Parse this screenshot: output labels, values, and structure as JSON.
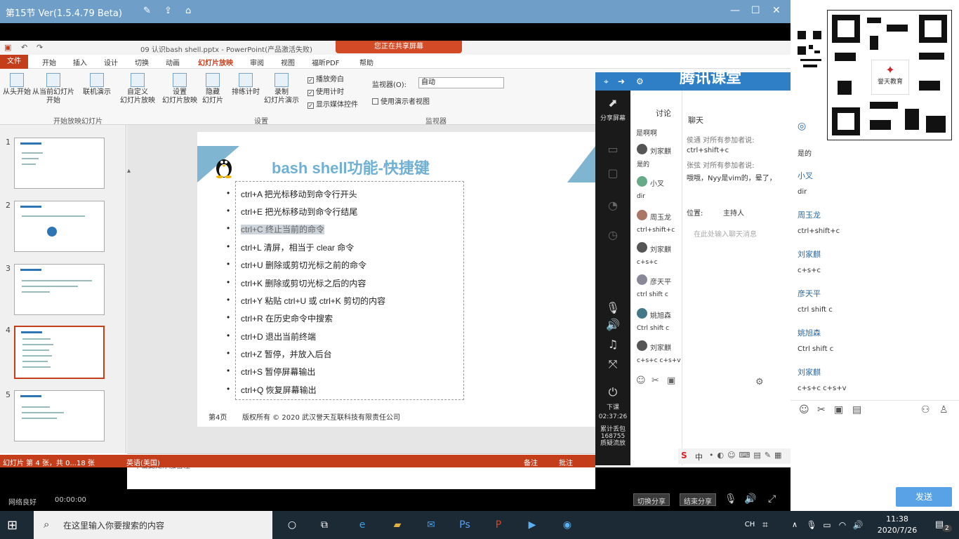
{
  "window": {
    "title": "第15节 Ver(1.5.4.79 Beta)"
  },
  "ppt": {
    "doc_title": "09 认识bash shell.pptx - PowerPoint(产品激活失败)",
    "share_banner": "您正在共享屏幕",
    "tabs": [
      "文件",
      "开始",
      "插入",
      "设计",
      "切换",
      "动画",
      "幻灯片放映",
      "审阅",
      "视图",
      "福昕PDF",
      "帮助"
    ],
    "ribbon": {
      "buttons": [
        {
          "label": "从头开始"
        },
        {
          "label": "从当前幻灯片\n开始"
        },
        {
          "label": "联机演示"
        },
        {
          "label": "自定义\n幻灯片放映"
        },
        {
          "label": "设置\n幻灯片放映"
        },
        {
          "label": "隐藏\n幻灯片"
        },
        {
          "label": "排练计时"
        },
        {
          "label": "录制\n幻灯片演示"
        }
      ],
      "checks": [
        {
          "label": "播放旁白",
          "checked": true
        },
        {
          "label": "使用计时",
          "checked": true
        },
        {
          "label": "显示媒体控件",
          "checked": true
        }
      ],
      "monitor_label": "监视器(O):",
      "monitor_value": "自动",
      "presenter_view": "使用演示者视图",
      "groups": [
        "开始放映幻灯片",
        "设置",
        "监视器"
      ]
    },
    "thumb_numbers": [
      "1",
      "2",
      "3",
      "4",
      "5"
    ],
    "slide": {
      "title": "bash shell功能-快捷键",
      "bullets": [
        "ctrl+A 把光标移动到命令行开头",
        "ctrl+E 把光标移动到命令行结尾",
        "ctrl+C 终止当前的命令",
        "ctrl+L 清屏，相当于 clear 命令",
        "ctrl+U 删除或剪切光标之前的命令",
        "ctrl+K 删除或剪切光标之后的内容",
        "ctrl+Y 粘贴 ctrl+U 或 ctrl+K 剪切的内容",
        "ctrl+R 在历史命令中搜索",
        "ctrl+D 退出当前终端",
        "ctrl+Z 暂停，并放入后台",
        "ctrl+S 暂停屏幕输出",
        "ctrl+Q 恢复屏幕输出"
      ],
      "highlighted_index": 2,
      "footer_page": "第4页",
      "footer_copy": "版权所有 © 2020 武汉誉天互联科技有限责任公司"
    },
    "notes_placeholder": "单击此处添加备注",
    "status": {
      "slide_info": "幻灯片 第 4 张，共 0...18 张",
      "language": "英语(美国)",
      "notes": "备注",
      "comments": "批注"
    }
  },
  "tencent": {
    "brand": "腾讯课堂",
    "left": {
      "share_screen": "分享屏幕",
      "end_class": "下课",
      "timer": "02:37:26",
      "stats": "累计丢包\n168755\n质疑流放"
    },
    "discuss_header": "讨论",
    "discuss_msgs": [
      {
        "name": "是啊啊",
        "body": ""
      },
      {
        "name": "刘家麒",
        "body": "是的"
      },
      {
        "name": "小叉",
        "body": "dir"
      },
      {
        "name": "周玉龙",
        "body": "ctrl+shift+c"
      },
      {
        "name": "刘家麒",
        "body": "c+s+c"
      },
      {
        "name": "彦天平",
        "body": "ctrl shift c"
      },
      {
        "name": "姚旭森",
        "body": "Ctrl shift c"
      },
      {
        "name": "刘家麒",
        "body": "c+s+c  c+s+v"
      }
    ],
    "chat": {
      "header": "聊天",
      "lines": [
        {
          "text": "侯通 对所有参加者说:",
          "note": true
        },
        {
          "text": "ctrl+shift+c",
          "note": false
        },
        {
          "text": "张弦 对所有参加者说:",
          "note": true
        },
        {
          "text": "哦哦，Nyy是vim的，晕了，",
          "note": false
        }
      ],
      "position_label": "位置:",
      "position_value": "主持人",
      "input_placeholder": "在此处输入聊天消息"
    }
  },
  "sidebar": {
    "messages": [
      {
        "name": "",
        "body": "是的"
      },
      {
        "name": "小叉",
        "body": "dir"
      },
      {
        "name": "周玉龙",
        "body": "ctrl+shift+c"
      },
      {
        "name": "刘家麒",
        "body": "c+s+c"
      },
      {
        "name": "彦天平",
        "body": "ctrl shift c"
      },
      {
        "name": "姚旭森",
        "body": "Ctrl shift c"
      },
      {
        "name": "刘家麒",
        "body": "c+s+c  c+s+v"
      }
    ],
    "send": "发送",
    "qr_caption": "誉天教育"
  },
  "ctrlbar": {
    "network": "网络良好",
    "time": "00:00:00",
    "btn1": "切换分享",
    "btn2": "结束分享"
  },
  "taskbar": {
    "search_placeholder": "在这里输入你要搜索的内容",
    "ime": "CH",
    "time": "11:38",
    "date": "2020/7/26",
    "notif_count": "2"
  },
  "colors": {
    "ppt_accent": "#c43e1c",
    "title_bar": "#6f9fc9",
    "tencent_blue": "#2f7fc6",
    "slide_title": "#6fb0d4"
  }
}
